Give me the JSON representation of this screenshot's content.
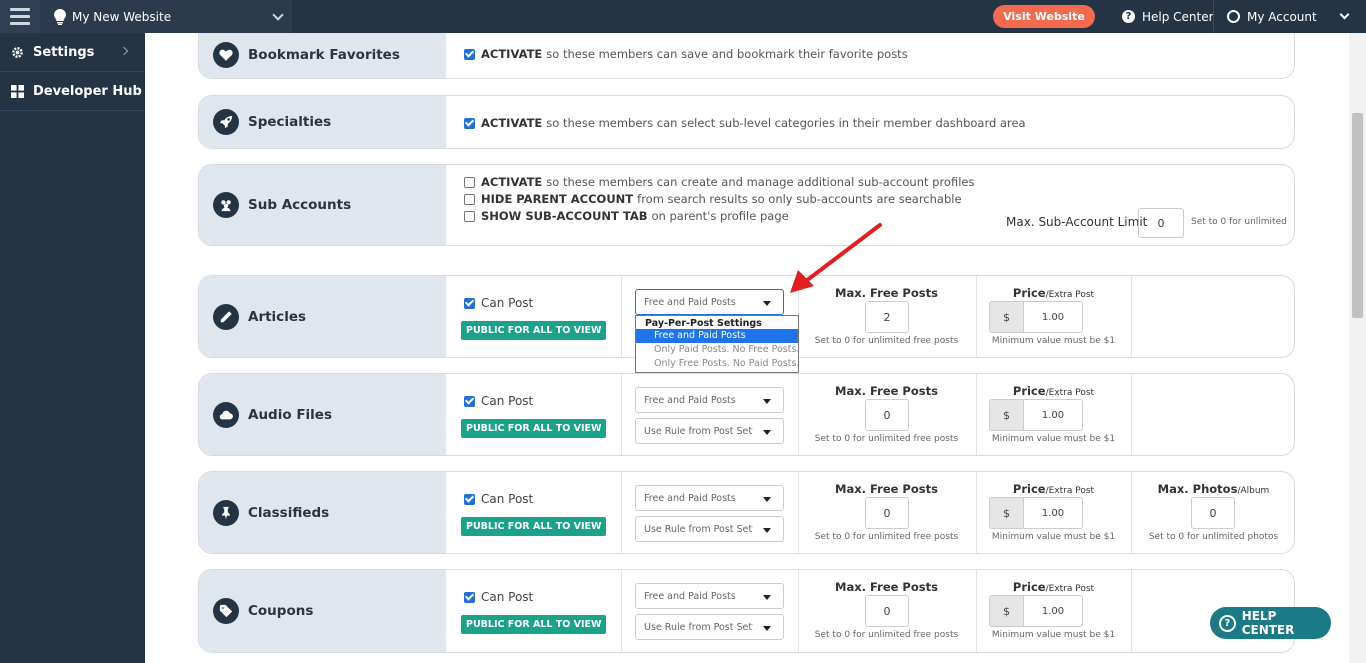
{
  "topbar": {
    "site_name": "My New Website",
    "visit_label": "Visit Website",
    "help_label": "Help Center",
    "account_label": "My Account"
  },
  "sidebar": {
    "items": [
      {
        "label": "Settings",
        "icon": "gear-icon"
      },
      {
        "label": "Developer Hub",
        "icon": "grid-icon"
      }
    ]
  },
  "features": {
    "bookmark": {
      "title": "Bookmark Favorites",
      "options": [
        {
          "bold": "ACTIVATE",
          "text": "so these members can save and bookmark their favorite posts",
          "checked": true
        }
      ]
    },
    "specialties": {
      "title": "Specialties",
      "options": [
        {
          "bold": "ACTIVATE",
          "text": "so these members can select sub-level categories in their member dashboard area",
          "checked": true
        }
      ]
    },
    "subaccounts": {
      "title": "Sub Accounts",
      "options": [
        {
          "bold": "ACTIVATE",
          "text": "so these members can create and manage additional sub-account profiles",
          "checked": false
        },
        {
          "bold": "HIDE PARENT ACCOUNT",
          "text": "from search results so only sub-accounts are searchable",
          "checked": false
        },
        {
          "bold": "SHOW SUB-ACCOUNT TAB",
          "text": "on parent's profile page",
          "checked": false
        }
      ],
      "limit_label": "Max. Sub-Account Limit",
      "limit_value": "0",
      "limit_note": "Set to 0 for unlimited"
    }
  },
  "post_types": [
    {
      "title": "Articles",
      "can_post": "Can Post",
      "badge": "PUBLIC FOR ALL TO VIEW",
      "pricing": "Free and Paid Posts",
      "rule": "",
      "max_free_title": "Max. Free Posts",
      "max_free": "2",
      "max_free_note": "Set to 0 for unlimited free posts",
      "price_title": "Price",
      "price_sub": "/Extra Post",
      "currency": "$",
      "price": "1.00",
      "price_note": "Minimum value must be $1"
    },
    {
      "title": "Audio Files",
      "can_post": "Can Post",
      "badge": "PUBLIC FOR ALL TO VIEW",
      "pricing": "Free and Paid Posts",
      "rule": "Use Rule from Post Settings",
      "max_free_title": "Max. Free Posts",
      "max_free": "0",
      "max_free_note": "Set to 0 for unlimited free posts",
      "price_title": "Price",
      "price_sub": "/Extra Post",
      "currency": "$",
      "price": "1.00",
      "price_note": "Minimum value must be $1"
    },
    {
      "title": "Classifieds",
      "can_post": "Can Post",
      "badge": "PUBLIC FOR ALL TO VIEW",
      "pricing": "Free and Paid Posts",
      "rule": "Use Rule from Post Settings",
      "max_free_title": "Max. Free Posts",
      "max_free": "0",
      "max_free_note": "Set to 0 for unlimited free posts",
      "price_title": "Price",
      "price_sub": "/Extra Post",
      "currency": "$",
      "price": "1.00",
      "price_note": "Minimum value must be $1",
      "photos_title": "Max. Photos",
      "photos_sub": "/Album",
      "photos": "0",
      "photos_note": "Set to 0 for unlimited photos"
    },
    {
      "title": "Coupons",
      "can_post": "Can Post",
      "badge": "PUBLIC FOR ALL TO VIEW",
      "pricing": "Free and Paid Posts",
      "rule": "Use Rule from Post Settings",
      "max_free_title": "Max. Free Posts",
      "max_free": "0",
      "max_free_note": "Set to 0 for unlimited free posts",
      "price_title": "Price",
      "price_sub": "/Extra Post",
      "currency": "$",
      "price": "1.00",
      "price_note": "Minimum value must be $1"
    }
  ],
  "dropdown": {
    "group_label": "Pay-Per-Post Settings",
    "options": [
      "Free and Paid Posts",
      "Only Paid Posts. No Free Posts.",
      "Only Free Posts. No Paid Posts."
    ],
    "selected_index": 0
  },
  "help_button": "HELP CENTER",
  "colors": {
    "nav": "#253445",
    "accent": "#f26b4f",
    "badge": "#1aa38a",
    "arrow": "#e02020",
    "help": "#1c7a86"
  }
}
